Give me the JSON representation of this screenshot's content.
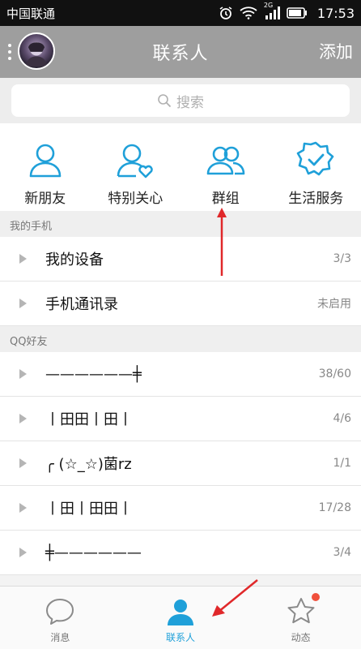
{
  "status_bar": {
    "carrier": "中国联通",
    "network": "2G",
    "time": "17:53"
  },
  "header": {
    "title": "联系人",
    "add_label": "添加"
  },
  "search": {
    "placeholder": "搜索"
  },
  "quick_actions": [
    {
      "label": "新朋友",
      "icon": "person-icon"
    },
    {
      "label": "特别关心",
      "icon": "person-heart-icon"
    },
    {
      "label": "群组",
      "icon": "group-icon"
    },
    {
      "label": "生活服务",
      "icon": "badge-check-icon"
    }
  ],
  "my_phone": {
    "header": "我的手机",
    "items": [
      {
        "label": "我的设备",
        "count": "3/3"
      },
      {
        "label": "手机通讯录",
        "count": "未启用"
      }
    ]
  },
  "qq_friends": {
    "header": "QQ好友",
    "items": [
      {
        "label": "——————╪",
        "count": "38/60"
      },
      {
        "label": "丨田田丨田丨",
        "count": "4/6"
      },
      {
        "label": "╭ (☆_☆)菌rz",
        "count": "1/1"
      },
      {
        "label": "丨田丨田田丨",
        "count": "17/28"
      },
      {
        "label": "╪——————",
        "count": "3/4"
      }
    ]
  },
  "bottom_nav": [
    {
      "label": "消息",
      "icon": "chat-bubble-icon",
      "active": false
    },
    {
      "label": "联系人",
      "icon": "contacts-icon",
      "active": true
    },
    {
      "label": "动态",
      "icon": "star-icon",
      "active": false,
      "badge": true
    }
  ],
  "colors": {
    "accent": "#1fa0d9",
    "header_bg": "#9e9e9e",
    "annotation_arrow": "#e0282a",
    "badge": "#f0503c"
  }
}
